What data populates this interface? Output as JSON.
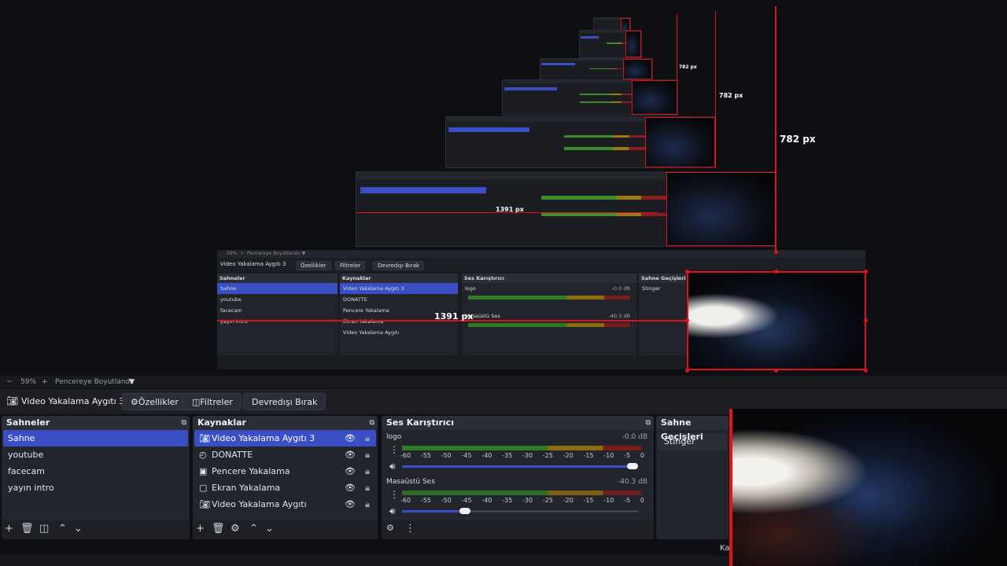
{
  "preview": {
    "measure_large": "782 px",
    "measure_mid": "782 px",
    "measure_small": "782 px",
    "measure_width": "1391 px",
    "measure_width_small": "1391 px",
    "nested": {
      "zoom": "59%",
      "fit": "Pencereye Boyutlandır",
      "source": "Video Yakalama Aygıtı 3",
      "props": "Özellikler",
      "filters": "Filtreler",
      "deactivate": "Devredışı Bırak",
      "scenes_title": "Sahneler",
      "scenes": [
        "Sahne",
        "youtube",
        "facecam",
        "yayın intro"
      ],
      "sources_title": "Kaynaklar",
      "sources": [
        "Video Yakalama Aygıtı 3",
        "DONATTE",
        "Pencere Yakalama",
        "Ekran Yakalama",
        "Video Yakalama Aygıtı"
      ],
      "mixer_title": "Ses Karıştırıcı",
      "mixer": [
        {
          "name": "logo",
          "db": "-0.0 dB"
        },
        {
          "name": "Masaüstü Ses",
          "db": "-40.3 dB"
        }
      ],
      "transitions_title": "Sahne Geçişleri",
      "transition": "Stinger"
    }
  },
  "zoombar": {
    "minus": "−",
    "zoom": "59%",
    "plus": "+",
    "fit_label": "Pencereye Boyutlandır",
    "arrow": "▼"
  },
  "source_toolbar": {
    "current_source": "Video Yakalama Aygıtı 3",
    "properties": "Özellikler",
    "filters": "Filtreler",
    "deactivate": "Devredışı Bırak"
  },
  "scenes": {
    "title": "Sahneler",
    "items": [
      "Sahne",
      "youtube",
      "facecam",
      "yayın intro"
    ],
    "active_index": 0
  },
  "sources": {
    "title": "Kaynaklar",
    "items": [
      {
        "label": "Video Yakalama Aygıtı 3",
        "icon": "camera-icon"
      },
      {
        "label": "DONATTE",
        "icon": "browser-icon"
      },
      {
        "label": "Pencere Yakalama",
        "icon": "window-icon"
      },
      {
        "label": "Ekran Yakalama",
        "icon": "monitor-icon"
      },
      {
        "label": "Video Yakalama Aygıtı",
        "icon": "camera-icon"
      }
    ],
    "active_index": 0
  },
  "mixer": {
    "title": "Ses Karıştırıcı",
    "ticks": [
      "-60",
      "-55",
      "-50",
      "-45",
      "-40",
      "-35",
      "-30",
      "-25",
      "-20",
      "-15",
      "-10",
      "-5",
      "0"
    ],
    "channels": [
      {
        "name": "logo",
        "db": "-0.0 dB",
        "volume": 1.0
      },
      {
        "name": "Masaüstü Ses",
        "db": "-40.3 dB",
        "volume": 0.29
      }
    ]
  },
  "transitions": {
    "title": "Sahne Geçişleri",
    "selected": "Stinger"
  },
  "status": {
    "partial_label": "Ka"
  },
  "colors": {
    "accent": "#3b4fc4",
    "measure_red": "#d9141b",
    "panel": "#23252c",
    "background": "#0e0f12"
  }
}
